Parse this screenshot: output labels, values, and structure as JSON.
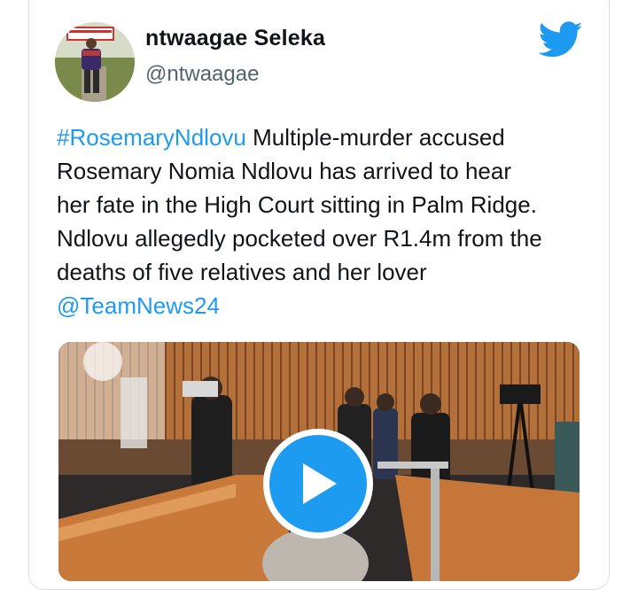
{
  "tweet": {
    "author": {
      "display_name": "ntwaagae Seleka",
      "handle": "@ntwaagae",
      "avatar_icon": "profile-photo"
    },
    "text": {
      "hashtag": "#RosemaryNdlovu",
      "line1_rest": " Multiple-murder accused",
      "line2": "Rosemary Nomia Ndlovu has arrived to hear",
      "line3": "her fate in the High Court sitting in Palm Ridge.",
      "line4": "Ndlovu allegedly pocketed over R1.4m from the",
      "line5": "deaths of five relatives and her lover",
      "mention": "@TeamNews24"
    },
    "media": {
      "type": "video",
      "play_icon": "play-icon"
    }
  },
  "brand": {
    "logo_icon": "twitter-bird-icon",
    "accent_color": "#1d9bf0"
  }
}
